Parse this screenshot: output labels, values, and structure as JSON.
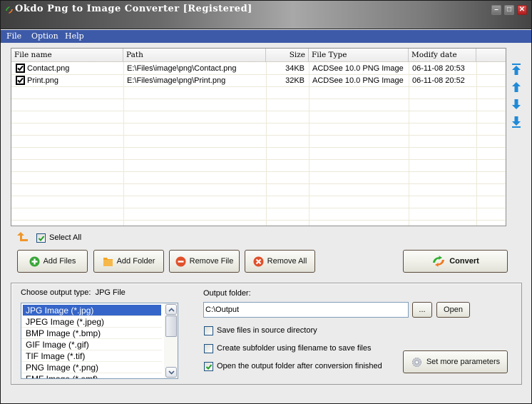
{
  "window": {
    "title": "Okdo Png to Image Converter [Registered]",
    "controls": {
      "minimize": "minimize-icon",
      "maximize": "maximize-icon",
      "close": "close-icon"
    }
  },
  "menu": {
    "items": [
      {
        "label": "File"
      },
      {
        "label": "Option"
      },
      {
        "label": "Help"
      }
    ]
  },
  "file_table": {
    "columns": [
      {
        "key": "name",
        "label": "File name"
      },
      {
        "key": "path",
        "label": "Path"
      },
      {
        "key": "size",
        "label": "Size"
      },
      {
        "key": "type",
        "label": "File Type"
      },
      {
        "key": "date",
        "label": "Modify date"
      },
      {
        "key": "extra",
        "label": ""
      }
    ],
    "rows": [
      {
        "checked": true,
        "name": "Contact.png",
        "path": "E:\\Files\\image\\png\\Contact.png",
        "size": "34KB",
        "type": "ACDSee 10.0 PNG Image",
        "date": "06-11-08 20:53"
      },
      {
        "checked": true,
        "name": "Print.png",
        "path": "E:\\Files\\image\\png\\Print.png",
        "size": "32KB",
        "type": "ACDSee 10.0 PNG Image",
        "date": "06-11-08 20:52"
      }
    ]
  },
  "side_buttons": [
    {
      "name": "move-top",
      "icon": "arrow-top-icon"
    },
    {
      "name": "move-up",
      "icon": "arrow-up-icon"
    },
    {
      "name": "move-down",
      "icon": "arrow-down-icon"
    },
    {
      "name": "move-bottom",
      "icon": "arrow-bottom-icon"
    }
  ],
  "select_all": {
    "label": "Select All",
    "checked": true
  },
  "buttons": {
    "add_files": "Add Files",
    "add_folder": "Add Folder",
    "remove_file": "Remove File",
    "remove_all": "Remove All",
    "convert": "Convert",
    "browse": "...",
    "open": "Open",
    "set_more_parameters": "Set more parameters"
  },
  "output": {
    "type_label": "Choose output type:",
    "type_value": "JPG File",
    "formats": [
      {
        "label": "JPG Image (*.jpg)",
        "selected": true
      },
      {
        "label": "JPEG Image (*.jpeg)",
        "selected": false
      },
      {
        "label": "BMP Image (*.bmp)",
        "selected": false
      },
      {
        "label": "GIF Image (*.gif)",
        "selected": false
      },
      {
        "label": "TIF Image (*.tif)",
        "selected": false
      },
      {
        "label": "PNG Image (*.png)",
        "selected": false
      },
      {
        "label": "EMF Image (*.emf)",
        "selected": false
      }
    ],
    "folder_label": "Output folder:",
    "folder_value": "C:\\Output",
    "options": [
      {
        "label": "Save files in source directory",
        "checked": false
      },
      {
        "label": "Create subfolder using filename to save files",
        "checked": false
      },
      {
        "label": "Open the output folder after conversion finished",
        "checked": true
      }
    ]
  },
  "colors": {
    "menu_bar": "#3d5aa8",
    "selection": "#3565c8",
    "arrow_blue": "#1f8ad8",
    "add_green": "#3aa63a",
    "remove_red": "#e0502a"
  }
}
